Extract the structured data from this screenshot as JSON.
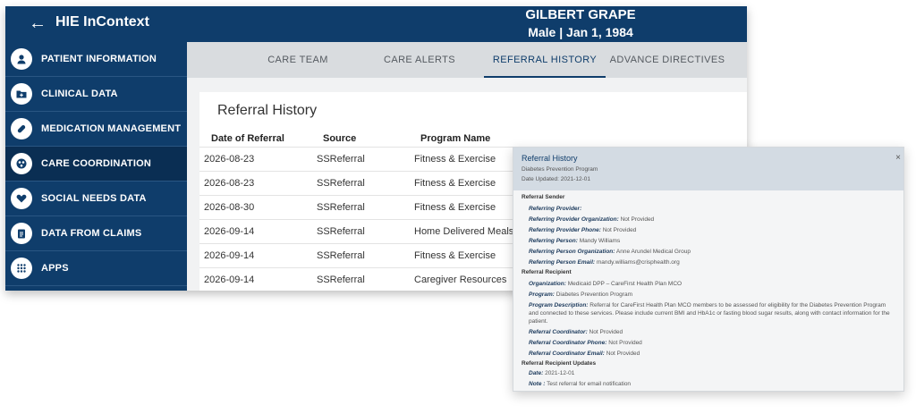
{
  "header": {
    "back_glyph": "←",
    "app_title": "HIE InContext",
    "patient_name": "GILBERT GRAPE",
    "patient_meta": "Male | Jan 1, 1984"
  },
  "sidebar": {
    "items": [
      {
        "label": "PATIENT INFORMATION",
        "icon": "person-icon"
      },
      {
        "label": "CLINICAL DATA",
        "icon": "folder-plus-icon"
      },
      {
        "label": "MEDICATION MANAGEMENT",
        "icon": "pill-icon"
      },
      {
        "label": "CARE COORDINATION",
        "icon": "network-icon"
      },
      {
        "label": "SOCIAL NEEDS DATA",
        "icon": "heart-hands-icon"
      },
      {
        "label": "DATA FROM CLAIMS",
        "icon": "clipboard-icon"
      },
      {
        "label": "APPS",
        "icon": "grid-icon"
      }
    ]
  },
  "tabs": [
    {
      "label": "CARE TEAM"
    },
    {
      "label": "CARE ALERTS"
    },
    {
      "label": "REFERRAL HISTORY"
    },
    {
      "label": "ADVANCE DIRECTIVES"
    }
  ],
  "referral": {
    "title": "Referral History",
    "columns": [
      "Date of Referral",
      "Source",
      "Program Name"
    ],
    "rows": [
      {
        "date": "2026-08-23",
        "source": "SSReferral",
        "program": "Fitness & Exercise"
      },
      {
        "date": "2026-08-23",
        "source": "SSReferral",
        "program": "Fitness & Exercise"
      },
      {
        "date": "2026-08-30",
        "source": "SSReferral",
        "program": "Fitness & Exercise"
      },
      {
        "date": "2026-09-14",
        "source": "SSReferral",
        "program": "Home Delivered Meals"
      },
      {
        "date": "2026-09-14",
        "source": "SSReferral",
        "program": "Fitness & Exercise"
      },
      {
        "date": "2026-09-14",
        "source": "SSReferral",
        "program": "Caregiver Resources"
      }
    ]
  },
  "modal": {
    "title": "Referral History",
    "program": "Diabetes Prevention Program",
    "date_updated": "Date Updated: 2021-12-01",
    "close_glyph": "×",
    "sender_heading": "Referral Sender",
    "sender": [
      {
        "label": "Referring Provider:",
        "value": ""
      },
      {
        "label": "Referring Provider Organization:",
        "value": "Not Provided"
      },
      {
        "label": "Referring Provider Phone:",
        "value": "Not Provided"
      },
      {
        "label": "Referring Person:",
        "value": "Mandy Williams"
      },
      {
        "label": "Referring Person Organization:",
        "value": "Anne Arundel Medical Group"
      },
      {
        "label": "Referring Person Email:",
        "value": "mandy.williams@crisphealth.org"
      }
    ],
    "recipient_heading": "Referral Recipient",
    "recipient_org": {
      "label": "Organization:",
      "value": "Medicaid DPP – CareFirst Health Plan MCO"
    },
    "recipient_program": {
      "label": "Program:",
      "value": "Diabetes Prevention Program"
    },
    "recipient_desc": {
      "label": "Program Description:",
      "value": "Referral for CareFirst Health Plan MCO members to be assessed for eligibility for the Diabetes Prevention Program and connected to these services. Please include current BMI and HbA1c or fasting blood sugar results, along with contact information for the patient."
    },
    "recipient_coord": [
      {
        "label": "Referral Coordinator:",
        "value": "Not Provided"
      },
      {
        "label": "Referral Coordinator Phone:",
        "value": "Not Provided"
      },
      {
        "label": "Referral Coordinator Email:",
        "value": "Not Provided"
      }
    ],
    "updates_heading": "Referral Recipient Updates",
    "updates": [
      {
        "label": "Date:",
        "value": "2021-12-01"
      },
      {
        "label": "Note :",
        "value": "Test referral for email notification"
      }
    ]
  },
  "colors": {
    "brand": "#0f3d6b",
    "active_nav": "#0a2e53",
    "tabs_bg": "#d9dcdf",
    "modal_header": "#d3dbe3"
  }
}
